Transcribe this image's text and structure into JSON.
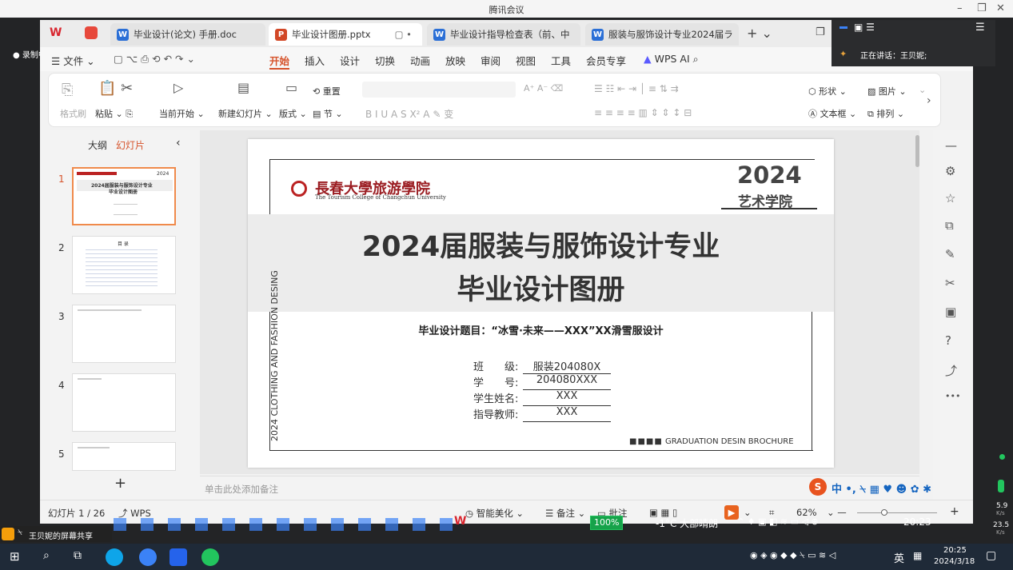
{
  "meeting": {
    "title": "腾讯会议",
    "rec_label": "录制中",
    "speaking": "正在讲话：王贝妮;",
    "share_label": "王贝妮的屏幕共享"
  },
  "tabs": [
    {
      "icon": "W",
      "label": "毕业设计(论文) 手册.doc"
    },
    {
      "icon": "P",
      "label": "毕业设计图册.pptx"
    },
    {
      "icon": "W",
      "label": "毕业设计指导检查表（前、中"
    },
    {
      "icon": "W",
      "label": "服装与服饰设计专业2024届ラ"
    }
  ],
  "menu": {
    "file": "文件",
    "items": [
      "开始",
      "插入",
      "设计",
      "切换",
      "动画",
      "放映",
      "审阅",
      "视图",
      "工具",
      "会员专享"
    ],
    "wps_ai": "WPS AI"
  },
  "ribbon": {
    "format_brush": "格式刷",
    "paste": "粘贴",
    "play_from_current": "当前开始",
    "new_slide": "新建幻灯片",
    "layout": "版式",
    "reset": "重置",
    "section": "节",
    "shape": "形状",
    "image": "图片",
    "textbox": "文本框",
    "arrange": "排列"
  },
  "panel": {
    "outline_tab": "大纲",
    "slides_tab": "幻灯片",
    "slide_numbers": [
      "1",
      "2",
      "3",
      "4",
      "5"
    ],
    "add": "+"
  },
  "slide": {
    "school_cn": "長春大學旅游學院",
    "school_en": "The Tourism College of Changchun University",
    "year": "2024",
    "dept": "艺术学院",
    "title_line1": "2024届服装与服饰设计专业",
    "title_line2": "毕业设计图册",
    "topic": "毕业设计题目：“冰雪·未来——XXX”XX滑雪服设计",
    "vertical_text": "2024 CLOTHING AND FASHION DESING",
    "fields": [
      {
        "label": "班　　级:",
        "value": "服装204080X"
      },
      {
        "label": "学　　号:",
        "value": "204080XXX"
      },
      {
        "label": "学生姓名:",
        "value": "XXX"
      },
      {
        "label": "指导教师:",
        "value": "XXX"
      }
    ],
    "brochure": "GRADUATION DESIN BROCHURE"
  },
  "notes_placeholder": "单击此处添加备注",
  "status": {
    "slide_count": "幻灯片 1 / 26",
    "wps": "WPS",
    "beautify": "智能美化",
    "notes": "备注",
    "comments": "批注",
    "zoom": "62%"
  },
  "inner_taskbar": {
    "battery": "100%",
    "weather": "-1°C 大部晴朗",
    "time": "20:23"
  },
  "net": {
    "up": "5.9",
    "down": "23.5",
    "unit": "K/s"
  },
  "taskbar": {
    "lang": "英",
    "time": "20:25",
    "date": "2024/3/18"
  }
}
